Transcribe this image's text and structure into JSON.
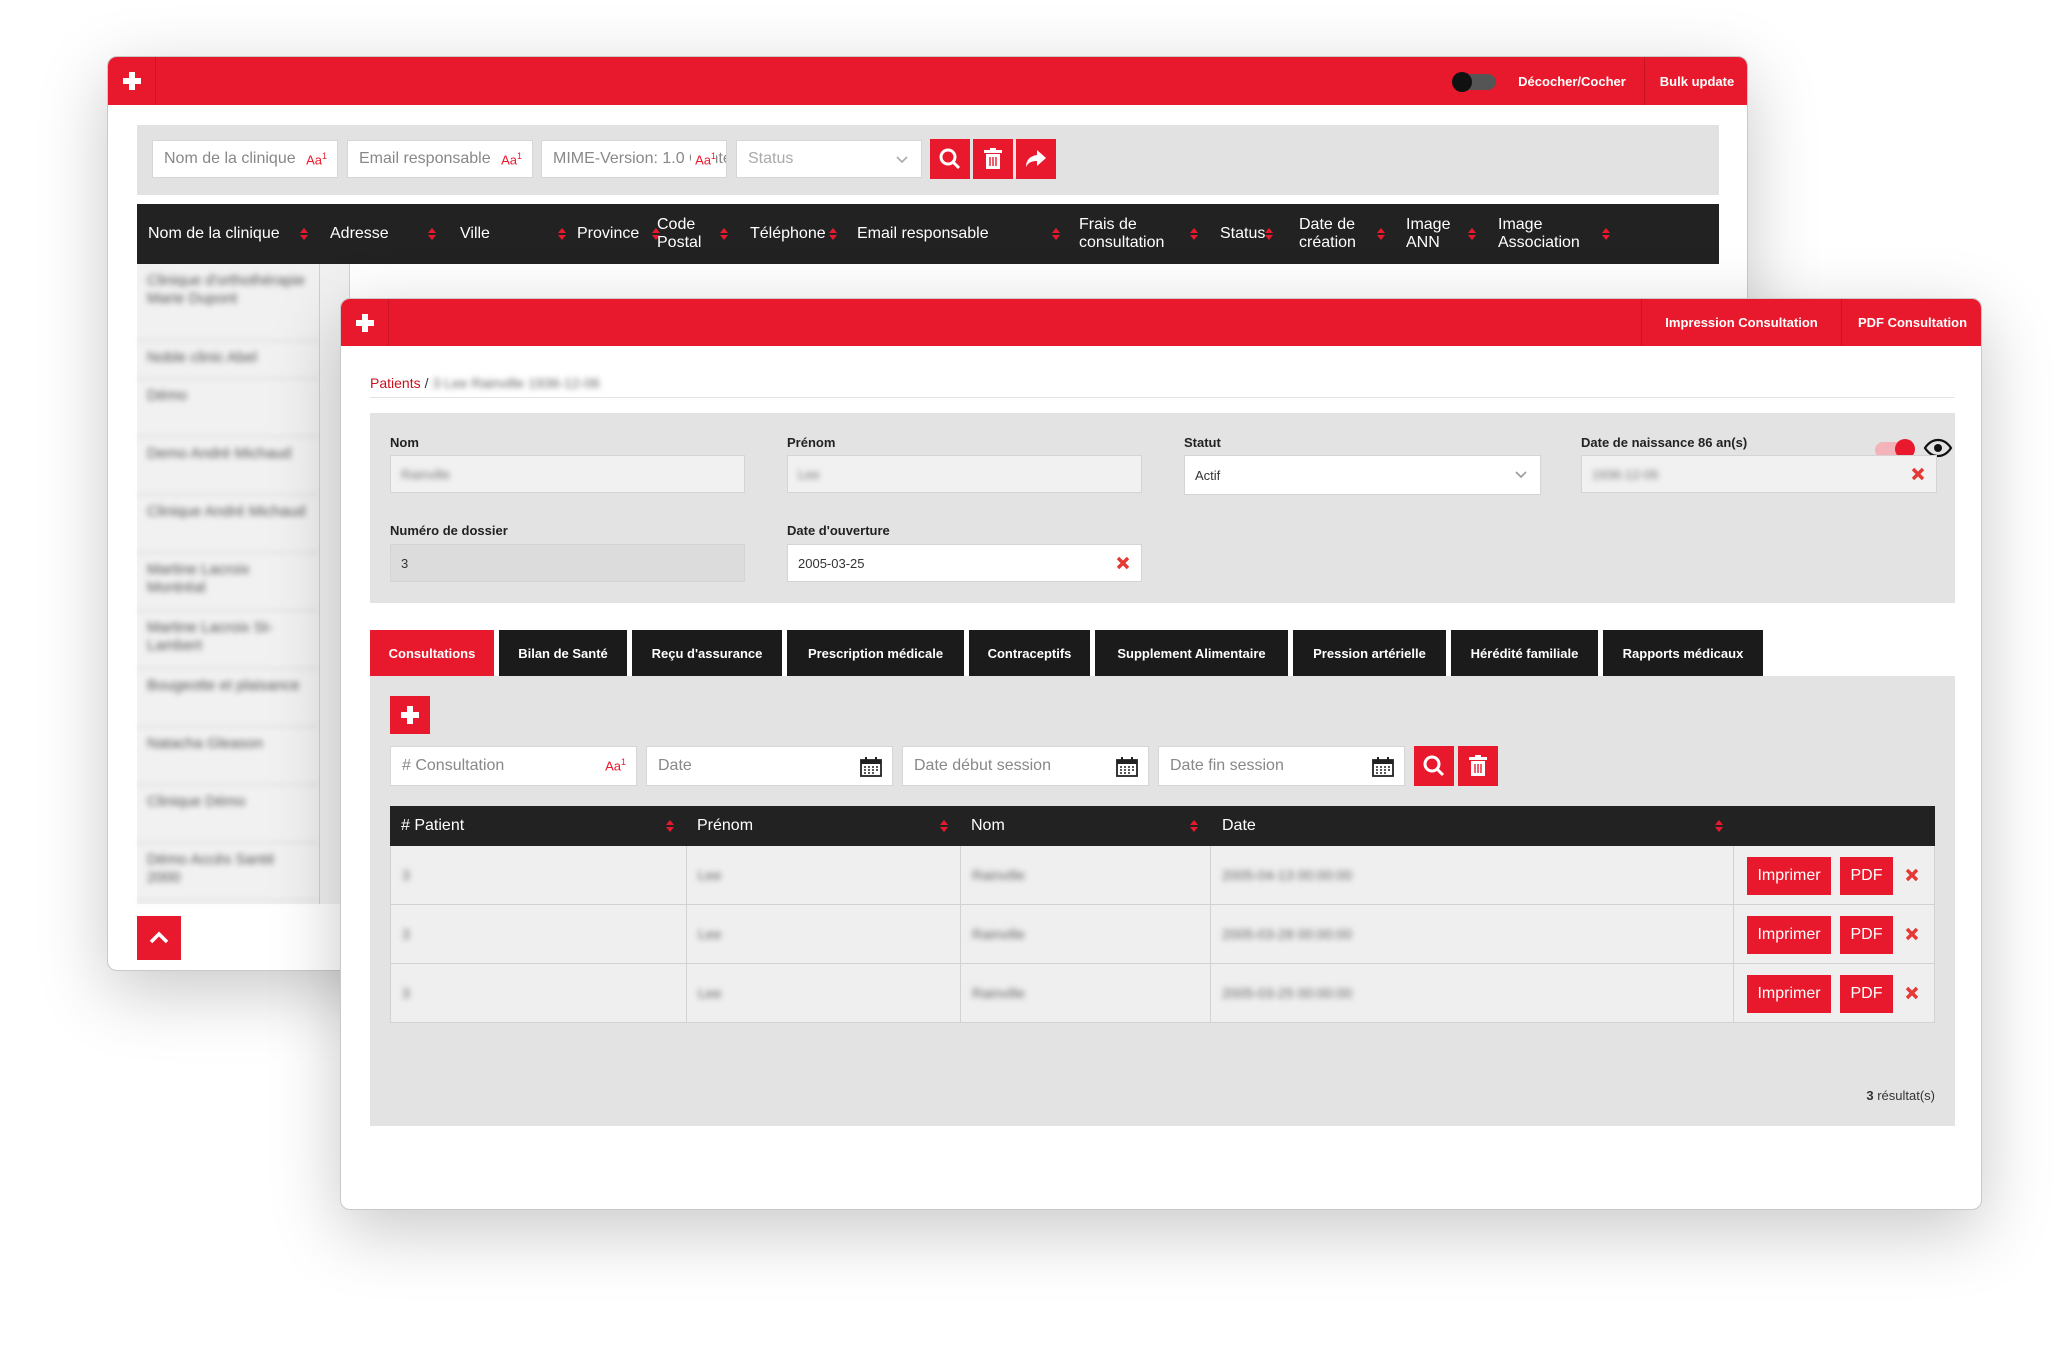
{
  "back_window": {
    "bar": {
      "toggle_label": "Décocher/Cocher",
      "bulk_update_label": "Bulk update"
    },
    "filters": {
      "clinic_name_placeholder": "Nom de la clinique",
      "email_placeholder": "Email responsable",
      "mime_placeholder": "MIME-Version: 1.0 Conter",
      "status_placeholder": "Status",
      "case_marker": "Aa"
    },
    "columns": [
      "Nom de la clinique",
      "Adresse",
      "Ville",
      "Province",
      "Code Postal",
      "Téléphone",
      "Email responsable",
      "Frais de consultation",
      "Status",
      "Date de création",
      "Image ANN",
      "Image Association"
    ],
    "clinic_names": [
      "Clinique d'orthothérapie Marie Dupont",
      "Noble clinic Abel",
      "Démo",
      "Demo André Michaud",
      "Clinique André Michaud",
      "Martine Lacroix Montréal",
      "Martine Lacroix St-Lambert",
      "Bougeotte et plaisance",
      "Natacha Gleason",
      "Clinique Démo",
      "Démo Accès Santé 2000"
    ]
  },
  "front_window": {
    "bar": {
      "print_label": "Impression Consultation",
      "pdf_label": "PDF Consultation"
    },
    "breadcrumb": {
      "link": "Patients",
      "separator": "/",
      "current": "3 Lee Rainville 1936-12-06"
    },
    "form": {
      "nom_label": "Nom",
      "nom_value": "Rainville",
      "prenom_label": "Prénom",
      "prenom_value": "Lee",
      "statut_label": "Statut",
      "statut_value": "Actif",
      "dob_label": "Date de naissance 86 an(s)",
      "dob_value": "1936-12-06",
      "dossier_label": "Numéro de dossier",
      "dossier_value": "3",
      "ouverture_label": "Date d'ouverture",
      "ouverture_value": "2005-03-25"
    },
    "tabs": [
      "Consultations",
      "Bilan de Santé",
      "Reçu d'assurance",
      "Prescription médicale",
      "Contraceptifs",
      "Supplement Alimentaire",
      "Pression artérielle",
      "Hérédité familiale",
      "Rapports médicaux"
    ],
    "consult_filters": {
      "consultation_placeholder": "# Consultation",
      "date_placeholder": "Date",
      "start_placeholder": "Date début session",
      "end_placeholder": "Date fin session",
      "case_marker": "Aa"
    },
    "table": {
      "headers": [
        "# Patient",
        "Prénom",
        "Nom",
        "Date"
      ],
      "rows": [
        {
          "patient": "3",
          "prenom": "Lee",
          "nom": "Rainville",
          "date": "2005-04-13 00:00:00"
        },
        {
          "patient": "3",
          "prenom": "Lee",
          "nom": "Rainville",
          "date": "2005-03-28 00:00:00"
        },
        {
          "patient": "3",
          "prenom": "Lee",
          "nom": "Rainville",
          "date": "2005-03-25 00:00:00"
        }
      ],
      "print_label": "Imprimer",
      "pdf_label": "PDF"
    },
    "results": {
      "count": "3",
      "label": "résultat(s)"
    }
  },
  "colors": {
    "accent": "#e8192c",
    "dark": "#222222",
    "panel": "#e3e3e3"
  }
}
